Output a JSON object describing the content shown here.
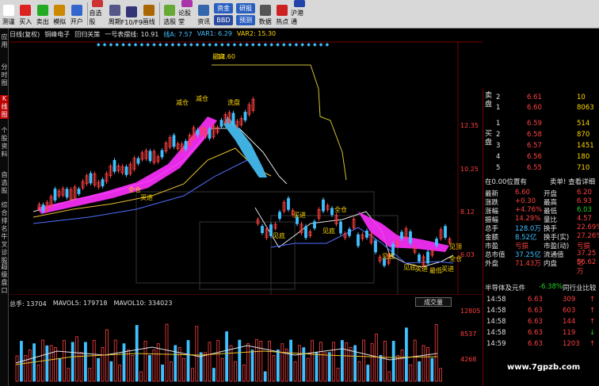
{
  "toolbar": {
    "buttons": [
      {
        "label": "测谨",
        "icon": "cursor-icon"
      },
      {
        "label": "买入",
        "icon": "buy-icon"
      },
      {
        "label": "卖出",
        "icon": "sell-icon"
      },
      {
        "label": "模拟",
        "icon": "hammer-icon"
      },
      {
        "label": "开户",
        "icon": "open-account-icon"
      },
      {
        "label": "自选股",
        "icon": "watchlist-icon"
      },
      {
        "label": "周期",
        "icon": "period-icon"
      },
      {
        "label": "F10/F9",
        "icon": "f10-icon"
      },
      {
        "label": "画线",
        "icon": "draw-line-icon"
      },
      {
        "label": "选股",
        "icon": "stock-picker-icon"
      },
      {
        "label": "论股堂",
        "icon": "forum-icon"
      },
      {
        "label": "资讯",
        "icon": "news-icon"
      }
    ],
    "box1": [
      "资金",
      "BBD"
    ],
    "box2": [
      "研报",
      "预测"
    ],
    "buttons_right": [
      {
        "label": "数据",
        "icon": "data-icon"
      },
      {
        "label": "热点",
        "icon": "hotspot-icon"
      },
      {
        "label": "沪港通",
        "icon": "connect-icon"
      }
    ]
  },
  "sidebar": [
    "应用",
    "分时图",
    "K线图",
    "个股资料",
    "自选股",
    "综合排名",
    "牛叉诊股",
    "超级盘口"
  ],
  "chart_title": {
    "period": "日线(复权)",
    "name": "铜峰电子",
    "formula": "回归关策",
    "line1": "一号表摆线: 10.91",
    "line2": "线A: 7.57",
    "var1": "VAR1: 6.29",
    "var2": "VAR2: 15.30"
  },
  "annotations": [
    "最高",
    "12.60",
    "减仓",
    "洗盘",
    "买进",
    "全仓",
    "减仓",
    "见底",
    "买进",
    "见底",
    "全仓",
    "见底",
    "买进",
    "见底",
    "最低",
    "全仓",
    "买进",
    "见顶"
  ],
  "price_axis": [
    "12.35",
    "10.25",
    "8.12",
    "6.03"
  ],
  "volume": {
    "title": "总手: 13704",
    "mavol5": "MAVOL5: 179718",
    "mavol10": "MAVOL10: 334023",
    "axis": [
      "12805",
      "8537",
      "4268"
    ],
    "button": "成交量"
  },
  "order_book": {
    "sell": [
      {
        "label": "2",
        "price": "6.61",
        "vol": "10"
      },
      {
        "label": "1",
        "price": "6.60",
        "vol": "8063"
      }
    ],
    "buy": [
      {
        "label": "1",
        "price": "6.59",
        "vol": "514"
      },
      {
        "label": "2",
        "price": "6.58",
        "vol": "870"
      },
      {
        "label": "3",
        "price": "6.57",
        "vol": "1451"
      },
      {
        "label": "4",
        "price": "6.56",
        "vol": "180"
      },
      {
        "label": "5",
        "price": "6.55",
        "vol": "710"
      }
    ],
    "sell_side_label": "卖盘",
    "buy_side_label": "买盘"
  },
  "position_row": {
    "left": "在0.00位置有",
    "right": "卖单! 查看详细"
  },
  "quote": [
    {
      "k1": "最新",
      "v1": "6.60",
      "k2": "开盘",
      "v2": "6.20"
    },
    {
      "k1": "涨跌",
      "v1": "+0.30",
      "k2": "最高",
      "v2": "6.93"
    },
    {
      "k1": "涨幅",
      "v1": "+4.76%",
      "k2": "最低",
      "v2": "6.03"
    },
    {
      "k1": "振幅",
      "v1": "14.29%",
      "k2": "量比",
      "v2": "4.57"
    },
    {
      "k1": "总手",
      "v1": "128.0万",
      "k2": "换手",
      "v2": "22.69%"
    },
    {
      "k1": "金额",
      "v1": "8.52亿",
      "k2": "换手(实)",
      "v2": "27.26%"
    },
    {
      "k1": "市盈",
      "v1": "亏损",
      "k2": "市盈(动)",
      "v2": "亏损"
    },
    {
      "k1": "总市值",
      "v1": "37.25亿",
      "k2": "流通值",
      "v2": "37.25亿"
    },
    {
      "k1": "外盘",
      "v1": "71.43万",
      "k2": "内盘",
      "v2": "56.62万"
    }
  ],
  "sector": {
    "name": "半导体及元件",
    "change": "-6.38%",
    "link": "同行业比较"
  },
  "ticks": [
    {
      "time": "14:58",
      "price": "6.63",
      "vol": "309"
    },
    {
      "time": "14:58",
      "price": "6.63",
      "vol": "603"
    },
    {
      "time": "14:58",
      "price": "6.63",
      "vol": "144"
    },
    {
      "time": "14:58",
      "price": "6.63",
      "vol": "119"
    },
    {
      "time": "14:59",
      "price": "6.63",
      "vol": "1203"
    }
  ],
  "watermark": "www.7gpzb.com",
  "colors": {
    "up": "#ff4040",
    "down": "#20d020",
    "accent": "#ffd700",
    "candle_down": "#40c0ff",
    "ribbon": "#ff30ff"
  }
}
